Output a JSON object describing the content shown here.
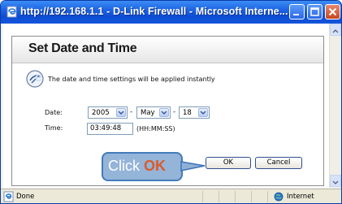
{
  "window": {
    "title": "http://192.168.1.1 - D-Link Firewall - Microsoft Interne..."
  },
  "background": {
    "callout_letter": "e"
  },
  "dialog": {
    "title": "Set Date and Time",
    "info_text": "The date and time settings will be applied instantly",
    "date_label": "Date:",
    "time_label": "Time:",
    "year": "2005",
    "month": "May",
    "day": "18",
    "separator": "-",
    "time_value": "03:49:48",
    "time_hint": "(HH:MM:SS)",
    "ok_label": "OK",
    "cancel_label": "Cancel"
  },
  "callout": {
    "prefix": "Click ",
    "emphasis": "OK"
  },
  "statusbar": {
    "status": "Done",
    "zone": "Internet"
  },
  "colors": {
    "titlebar": "#0d4cd3",
    "callout_fill": "#8fb0d6",
    "callout_emphasis": "#d9531e"
  }
}
